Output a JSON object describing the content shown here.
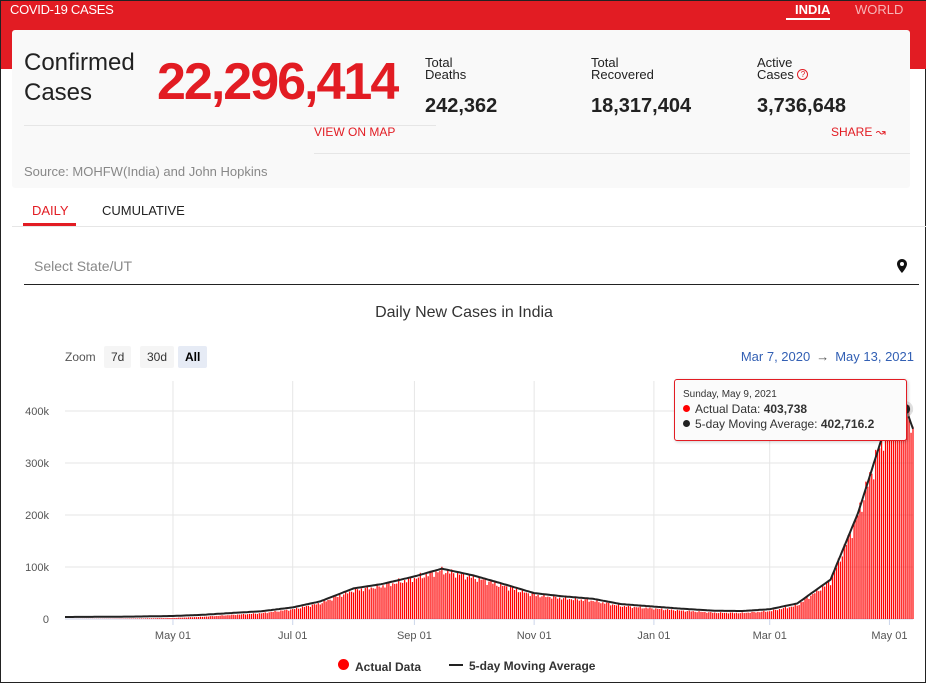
{
  "header": {
    "brand": "COVID-19 CASES",
    "regions": [
      "INDIA",
      "WORLD"
    ],
    "active_region": "INDIA"
  },
  "summary": {
    "confirmed_label_1": "Confirmed",
    "confirmed_label_2": "Cases",
    "confirmed": "22,296,414",
    "deaths_label_1": "Total",
    "deaths_label_2": "Deaths",
    "deaths": "242,362",
    "recovered_label_1": "Total",
    "recovered_label_2": "Recovered",
    "recovered": "18,317,404",
    "active_label_1": "Active",
    "active_label_2": "Cases",
    "active": "3,736,648",
    "help_icon": "?",
    "view_on_map": "VIEW ON MAP",
    "share": "SHARE",
    "source": "Source: MOHFW(India) and John Hopkins"
  },
  "tabs": [
    "DAILY",
    "CUMULATIVE"
  ],
  "select": {
    "placeholder": "Select State/UT"
  },
  "controls": {
    "zoom_label": "Zoom",
    "buttons": [
      "7d",
      "30d",
      "All"
    ],
    "active": "All",
    "range_from": "Mar 7, 2020",
    "range_arrow": "→",
    "range_to": "May 13, 2021"
  },
  "tooltip": {
    "date": "Sunday, May 9, 2021",
    "actual_label": "Actual Data: ",
    "actual_value": "403,738",
    "avg_label": "5-day Moving Average: ",
    "avg_value": "402,716.2"
  },
  "colors": {
    "brand": "#e21c23",
    "bar": "#ff0000",
    "line": "#222222"
  },
  "chart_data": {
    "type": "bar",
    "title": "Daily New Cases in India",
    "xlabel": "",
    "ylabel": "",
    "ylim": [
      0,
      440000
    ],
    "yticks": [
      0,
      100000,
      200000,
      300000,
      400000
    ],
    "ytick_labels": [
      "0",
      "100k",
      "200k",
      "300k",
      "400k"
    ],
    "xtick_labels": [
      "May 01",
      "Jul 01",
      "Sep 01",
      "Nov 01",
      "Jan 01",
      "Mar 01",
      "May 01"
    ],
    "xtick_dates": [
      "2020-05-01",
      "2020-07-01",
      "2020-09-01",
      "2020-11-01",
      "2021-01-01",
      "2021-03-01",
      "2021-05-01"
    ],
    "x_range": [
      "2020-03-07",
      "2021-05-13"
    ],
    "grid": true,
    "legend_position": "bottom",
    "series": [
      {
        "name": "Actual Data",
        "type": "bar"
      },
      {
        "name": "5-day Moving Average",
        "type": "line"
      }
    ],
    "points": [
      [
        "2020-03-07",
        0
      ],
      [
        "2020-04-01",
        500
      ],
      [
        "2020-04-15",
        1000
      ],
      [
        "2020-05-01",
        2000
      ],
      [
        "2020-05-15",
        4000
      ],
      [
        "2020-06-01",
        8000
      ],
      [
        "2020-06-15",
        11000
      ],
      [
        "2020-07-01",
        18500
      ],
      [
        "2020-07-15",
        30000
      ],
      [
        "2020-08-01",
        55000
      ],
      [
        "2020-08-15",
        63000
      ],
      [
        "2020-09-01",
        78000
      ],
      [
        "2020-09-15",
        93000
      ],
      [
        "2020-10-01",
        80000
      ],
      [
        "2020-10-15",
        65000
      ],
      [
        "2020-11-01",
        46000
      ],
      [
        "2020-11-15",
        40000
      ],
      [
        "2020-12-01",
        35000
      ],
      [
        "2020-12-15",
        25000
      ],
      [
        "2021-01-01",
        20000
      ],
      [
        "2021-01-15",
        16000
      ],
      [
        "2021-02-01",
        12000
      ],
      [
        "2021-02-15",
        11500
      ],
      [
        "2021-03-01",
        15000
      ],
      [
        "2021-03-15",
        26000
      ],
      [
        "2021-04-01",
        72000
      ],
      [
        "2021-04-15",
        200000
      ],
      [
        "2021-05-01",
        390000
      ],
      [
        "2021-05-09",
        403738
      ],
      [
        "2021-05-13",
        362000
      ]
    ]
  }
}
